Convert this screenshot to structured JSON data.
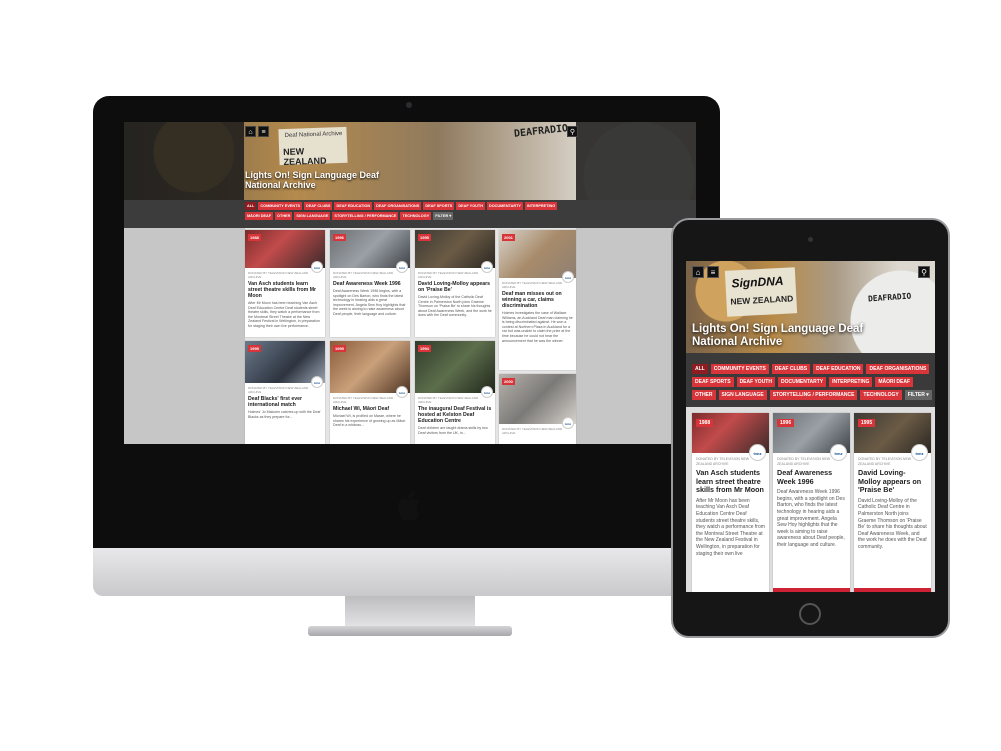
{
  "site": {
    "title": "Lights On! Sign Language Deaf National Archive",
    "label_line1": "Deaf National Archive",
    "label_line2": "NEW ZEALAND",
    "ipad_label_line1": "SignDNA",
    "ipad_label_line2": "NEW ZEALAND",
    "radio_label": "DEAFRADIO",
    "brand_red": "#d8353a"
  },
  "nav": {
    "home_icon": "home-icon",
    "menu_icon": "menu-icon",
    "search_icon": "search-icon"
  },
  "filters": [
    "All",
    "Community Events",
    "Deaf Clubs",
    "Deaf Education",
    "Deaf Organisations",
    "Deaf Sports",
    "Deaf Youth",
    "Documentarty",
    "Interpreting",
    "Māori Deaf",
    "Other",
    "Sign Language",
    "Storytelling / Performance",
    "Technology",
    "Filter ▾"
  ],
  "desktop_cards": [
    {
      "year": "1988",
      "source": "DONATED BY TELEVISION NEW ZEALAND ARCHIVE",
      "source_extra": "New Zealand Archive",
      "title": "Van Asch students learn street theatre skills from Mr Moon",
      "desc": "After Mr Moon has been teaching Van Asch Deaf Education Centre Deaf students street theatre skills, they watch a performance from the Montreal Street Theatre at the New Zealand Festival in Wellington, in preparation for staging their own live performance."
    },
    {
      "year": "1996",
      "source": "DONATED BY TELEVISION NEW ZEALAND ARCHIVE",
      "title": "Deaf Awareness Week 1996",
      "desc": "Deaf Awareness Week 1996 begins, with a spotlight on Des Barton, who finds the latest technology in hearing aids a great improvement. Angela Sew Hoy highlights that the week is aiming to raise awareness about Deaf people, their language and culture."
    },
    {
      "year": "1995",
      "source": "DONATED BY TELEVISION NEW ZEALAND ARCHIVE",
      "title": "David Loving-Molloy appears on 'Praise Be'",
      "desc": "David Loving-Molloy of the Catholic Deaf Centre in Palmerston North joins Graeme Thomson on 'Praise Be' to share his thoughts about Deaf Awareness Week, and the work he does with the Deaf community."
    },
    {
      "year": "2001",
      "source": "DONATED BY TELEVISION NEW ZEALAND ARCHIVE",
      "title": "Deaf man misses out on winning a car, claims discrimination",
      "desc": "Holmes investigates the case of Wallace Williams, an Auckland Deaf man claiming he is being discriminated against. He won a contest at Northern Plaza in Auckland for a car but was unable to claim the prize at the time because he could not hear the announcement that he was the winner."
    },
    {
      "year": "1995",
      "source": "DONATED BY TELEVISION NEW ZEALAND ARCHIVE",
      "title": "Deaf Blacks' first ever international match",
      "desc": "Holmes' Jo Malcolm catches up with the Deaf Blacks as they prepare for..."
    },
    {
      "year": "1995",
      "source": "DONATED BY TELEVISION NEW ZEALAND ARCHIVE",
      "title": "Michael Wi, Māori Deaf",
      "desc": "Michael Wi, is profiled on Marae, where he shares his experience of growing up as Māori Deaf in a whānau..."
    },
    {
      "year": "1994",
      "source": "DONATED BY TELEVISION NEW ZEALAND ARCHIVE",
      "title": "The inaugural Deaf Festival is hosted at Kelston Deaf Education Centre",
      "desc": "Deaf children are taught drama skills by two Deaf visitors from the UK, in..."
    },
    {
      "year": "2000",
      "source": "DONATED BY TELEVISION NEW ZEALAND ARCHIVE",
      "title": "",
      "desc": ""
    }
  ],
  "tablet_cards": [
    {
      "year": "1988",
      "source": "DONATED BY TELEVISION NEW ZEALAND ARCHIVE",
      "title": "Van Asch students learn street theatre skills from Mr Moon",
      "desc": "After Mr Moon has been teaching Van Asch Deaf Education Centre Deaf students street theatre skills, they watch a performance from the Montreal Street Theatre at the New Zealand Festival in Wellington, in preparation for staging their own live"
    },
    {
      "year": "1996",
      "source": "DONATED BY TELEVISION NEW ZEALAND ARCHIVE",
      "title": "Deaf Awareness Week 1996",
      "desc": "Deaf Awareness Week 1996 begins, with a spotlight on Des Barton, who finds the latest technology in hearing aids a great improvement. Angela Sew Hoy highlights that the week is aiming to raise awareness about Deaf people, their language and culture."
    },
    {
      "year": "1995",
      "source": "DONATED BY TELEVISION NEW ZEALAND ARCHIVE",
      "title": "David Loving-Molloy appears on 'Praise Be'",
      "desc": "David Loving-Molloy of the Catholic Deaf Centre in Palmerston North joins Graeme Thomson on 'Praise Be' to share his thoughts about Deaf Awareness Week, and the work he does with the Deaf community."
    }
  ],
  "channel_logo": "tvnz"
}
